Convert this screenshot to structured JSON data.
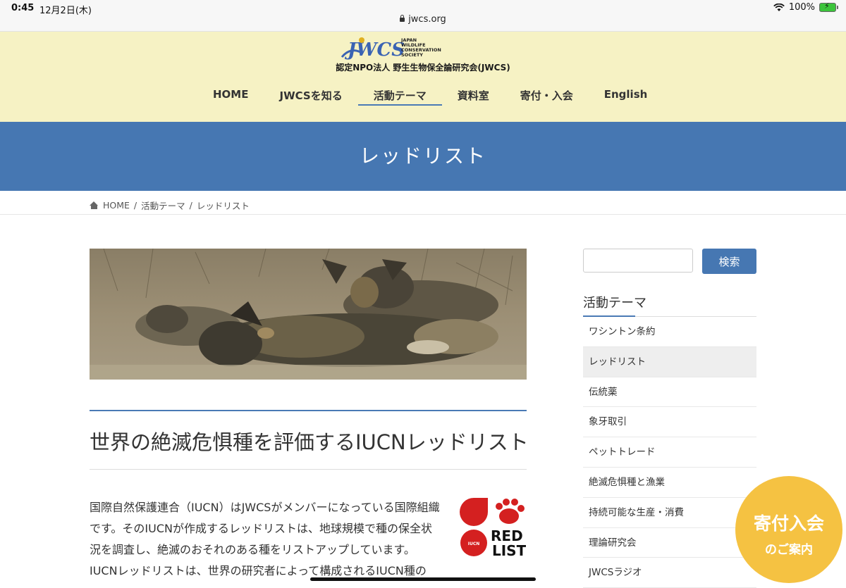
{
  "status_bar": {
    "time": "0:45",
    "date": "12月2日(木)",
    "url": "jwcs.org",
    "battery": "100%"
  },
  "header": {
    "logo_text": "JWCS",
    "logo_en": [
      "JAPAN",
      "WILDLIFE",
      "CONSERVATION",
      "SOCIETY"
    ],
    "org_name": "認定NPO法人 野生生物保全論研究会(JWCS)",
    "nav": [
      {
        "label": "HOME",
        "active": false
      },
      {
        "label": "JWCSを知る",
        "active": false
      },
      {
        "label": "活動テーマ",
        "active": true
      },
      {
        "label": "資料室",
        "active": false
      },
      {
        "label": "寄付・入会",
        "active": false
      },
      {
        "label": "English",
        "active": false
      }
    ]
  },
  "banner": {
    "title": "レッドリスト"
  },
  "breadcrumb": {
    "home": "HOME",
    "sep": "/",
    "level1": "活動テーマ",
    "current": "レッドリスト"
  },
  "article": {
    "title": "世界の絶滅危惧種を評価するIUCNレッドリスト",
    "body": "国際自然保護連合（IUCN）はJWCSがメンバーになっている国際組織です。そのIUCNが作成するレッドリストは、地球規模で種の保全状況を調査し、絶滅のおそれのある種をリストアップしています。IUCNレッドリストは、世界の研究者によって構成されるIUCN種の",
    "logo_text": {
      "red": "RED",
      "list": "LIST",
      "iucn": "IUCN"
    }
  },
  "sidebar": {
    "search_placeholder": "",
    "search_button": "検索",
    "heading": "活動テーマ",
    "items": [
      {
        "label": "ワシントン条約",
        "active": false
      },
      {
        "label": "レッドリスト",
        "active": true
      },
      {
        "label": "伝統薬",
        "active": false
      },
      {
        "label": "象牙取引",
        "active": false
      },
      {
        "label": "ペットトレード",
        "active": false
      },
      {
        "label": "絶滅危惧種と漁業",
        "active": false
      },
      {
        "label": "持続可能な生産・消費",
        "active": false
      },
      {
        "label": "理論研究会",
        "active": false
      },
      {
        "label": "JWCSラジオ",
        "active": false
      }
    ]
  },
  "donate": {
    "line1": "寄付入会",
    "line2": "のご案内"
  },
  "colors": {
    "header_bg": "#f6f2c4",
    "accent_blue": "#4677b2",
    "donate_yellow": "#f5c242",
    "redlist_red": "#d42020"
  }
}
